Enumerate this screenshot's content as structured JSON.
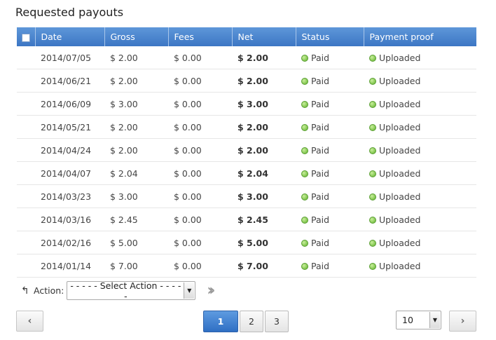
{
  "page": {
    "title": "Requested payouts"
  },
  "table": {
    "headers": {
      "date": "Date",
      "gross": "Gross",
      "fees": "Fees",
      "net": "Net",
      "status": "Status",
      "proof": "Payment proof"
    },
    "rows": [
      {
        "date": "2014/07/05",
        "gross": "$ 2.00",
        "fees": "$ 0.00",
        "net": "$ 2.00",
        "status": "Paid",
        "proof": "Uploaded"
      },
      {
        "date": "2014/06/21",
        "gross": "$ 2.00",
        "fees": "$ 0.00",
        "net": "$ 2.00",
        "status": "Paid",
        "proof": "Uploaded"
      },
      {
        "date": "2014/06/09",
        "gross": "$ 3.00",
        "fees": "$ 0.00",
        "net": "$ 3.00",
        "status": "Paid",
        "proof": "Uploaded"
      },
      {
        "date": "2014/05/21",
        "gross": "$ 2.00",
        "fees": "$ 0.00",
        "net": "$ 2.00",
        "status": "Paid",
        "proof": "Uploaded"
      },
      {
        "date": "2014/04/24",
        "gross": "$ 2.00",
        "fees": "$ 0.00",
        "net": "$ 2.00",
        "status": "Paid",
        "proof": "Uploaded"
      },
      {
        "date": "2014/04/07",
        "gross": "$ 2.04",
        "fees": "$ 0.00",
        "net": "$ 2.04",
        "status": "Paid",
        "proof": "Uploaded"
      },
      {
        "date": "2014/03/23",
        "gross": "$ 3.00",
        "fees": "$ 0.00",
        "net": "$ 3.00",
        "status": "Paid",
        "proof": "Uploaded"
      },
      {
        "date": "2014/03/16",
        "gross": "$ 2.45",
        "fees": "$ 0.00",
        "net": "$ 2.45",
        "status": "Paid",
        "proof": "Uploaded"
      },
      {
        "date": "2014/02/16",
        "gross": "$ 5.00",
        "fees": "$ 0.00",
        "net": "$ 5.00",
        "status": "Paid",
        "proof": "Uploaded"
      },
      {
        "date": "2014/01/14",
        "gross": "$ 7.00",
        "fees": "$ 0.00",
        "net": "$ 7.00",
        "status": "Paid",
        "proof": "Uploaded"
      }
    ]
  },
  "actions": {
    "icon": "level-up-arrow-icon",
    "label": "Action:",
    "selected": "- - - - - Select Action - - - - -",
    "go_icon": "double-chevron-right-icon"
  },
  "pagination": {
    "prev_icon": "chevron-left-icon",
    "next_icon": "chevron-right-icon",
    "pages": [
      "1",
      "2",
      "3"
    ],
    "current_page": "1",
    "per_page": "10"
  },
  "colors": {
    "header_blue": "#4a85d0",
    "active_page_blue": "#2f6fc4",
    "status_green": "#6cbf2e"
  }
}
